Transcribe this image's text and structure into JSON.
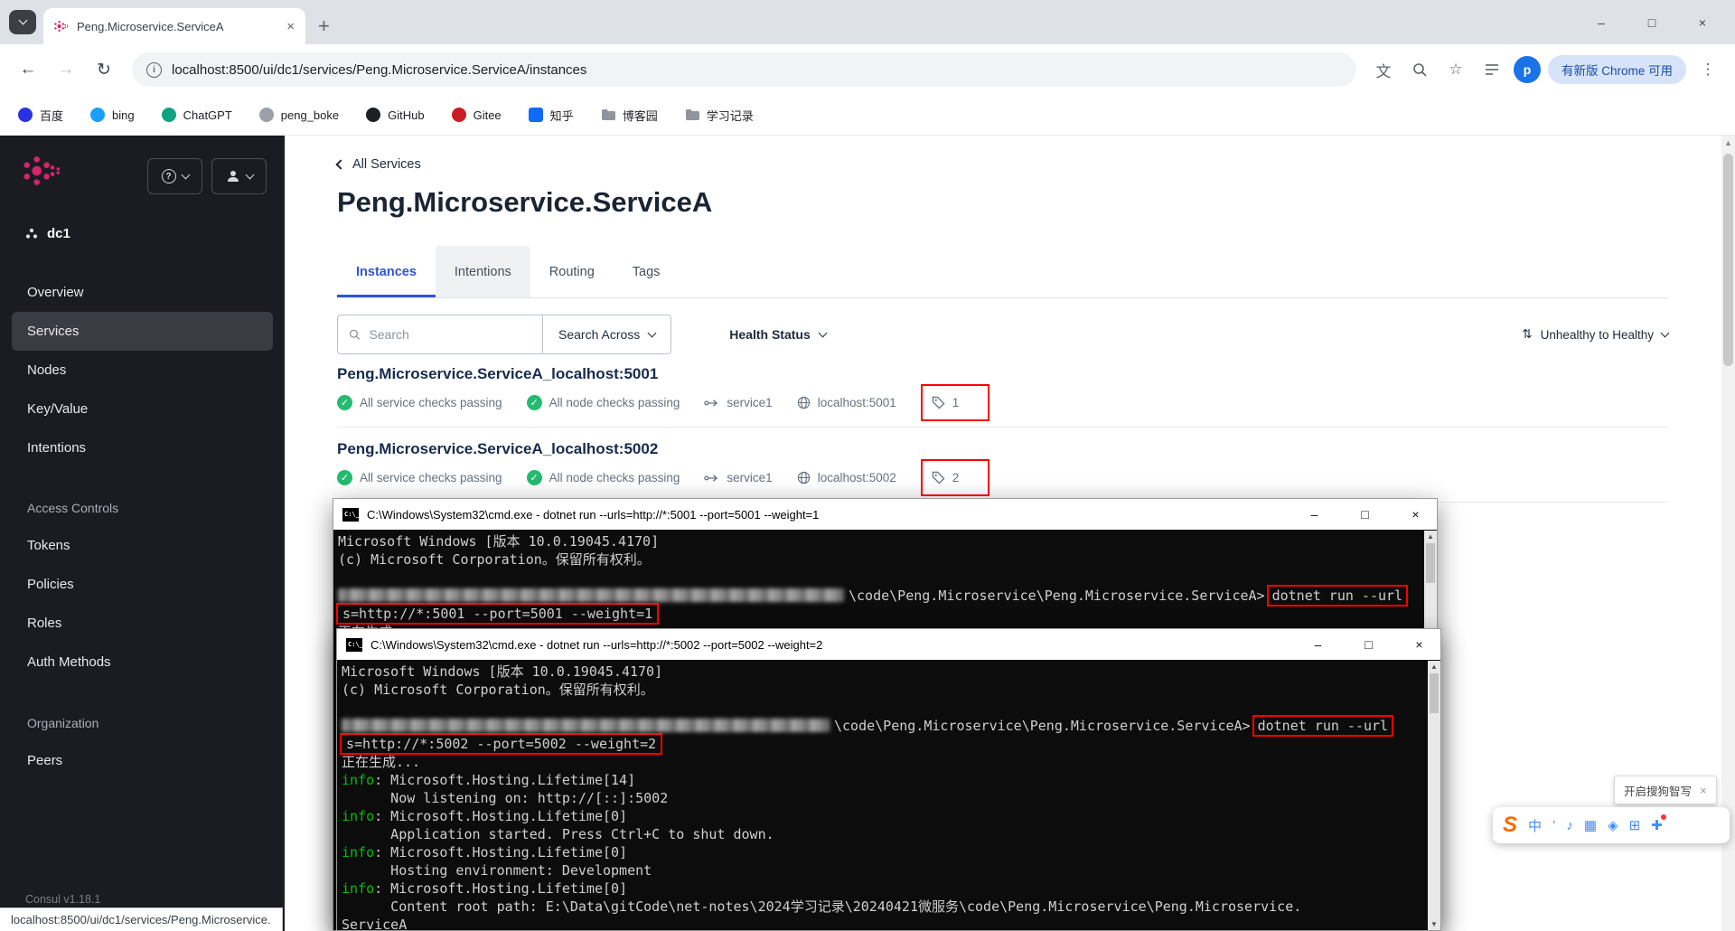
{
  "icons": {
    "check": "✓",
    "close": "×",
    "minimize": "–",
    "maximize": "□",
    "back": "←",
    "forward": "→",
    "reload": "↻",
    "star": "☆",
    "kebab": "⋮",
    "plus": "+",
    "sort": "⇅",
    "translate": "文",
    "info": "i",
    "question": "?",
    "up_arrow": "▲",
    "down_arrow": "▼",
    "cmd_logo": "C:\\_",
    "ime_logo": "S"
  },
  "browser": {
    "tab_title": "Peng.Microservice.ServiceA",
    "url": "localhost:8500/ui/dc1/services/Peng.Microservice.ServiceA/instances",
    "update_button": "有新版 Chrome 可用",
    "profile_initial": "p",
    "bookmarks": [
      "百度",
      "bing",
      "ChatGPT",
      "peng_boke",
      "GitHub",
      "Gitee",
      "知乎",
      "博客园",
      "学习记录"
    ]
  },
  "sidebar": {
    "dc": "dc1",
    "nav": [
      "Overview",
      "Services",
      "Nodes",
      "Key/Value",
      "Intentions"
    ],
    "acl_heading": "Access Controls",
    "acl_items": [
      "Tokens",
      "Policies",
      "Roles",
      "Auth Methods"
    ],
    "org_heading": "Organization",
    "peers": "Peers",
    "version": "Consul v1.18.1"
  },
  "main": {
    "back": "All Services",
    "title": "Peng.Microservice.ServiceA",
    "tabs": [
      "Instances",
      "Intentions",
      "Routing",
      "Tags"
    ],
    "search_placeholder": "Search",
    "search_across": "Search Across",
    "health_status": "Health Status",
    "sort_label": "Unhealthy to Healthy",
    "instances": [
      {
        "name": "Peng.Microservice.ServiceA_localhost:5001",
        "service_check": "All service checks passing",
        "node_check": "All node checks passing",
        "service": "service1",
        "address": "localhost:5001",
        "tag_count": "1"
      },
      {
        "name": "Peng.Microservice.ServiceA_localhost:5002",
        "service_check": "All service checks passing",
        "node_check": "All node checks passing",
        "service": "service1",
        "address": "localhost:5002",
        "tag_count": "2"
      }
    ]
  },
  "cmd1": {
    "title": "C:\\Windows\\System32\\cmd.exe - dotnet run --urls=http://*:5001 --port=5001 --weight=1",
    "lines": [
      {
        "text": "Microsoft Windows [版本 10.0.19045.4170]"
      },
      {
        "text": "(c) Microsoft Corporation。保留所有权利。"
      },
      {
        "text": ""
      },
      {
        "censored": true,
        "text": "\\code\\Peng.Microservice\\Peng.Microservice.ServiceA>",
        "tail": "dotnet run --url"
      },
      {
        "boxed": true,
        "text": "s=http://*:5001 --port=5001 --weight=1"
      },
      {
        "text": "正在生成..."
      }
    ]
  },
  "cmd2": {
    "title": "C:\\Windows\\System32\\cmd.exe - dotnet run --urls=http://*:5002 --port=5002 --weight=2",
    "lines": [
      {
        "text": "Microsoft Windows [版本 10.0.19045.4170]"
      },
      {
        "text": "(c) Microsoft Corporation。保留所有权利。"
      },
      {
        "text": ""
      },
      {
        "censored": true,
        "text": "\\code\\Peng.Microservice\\Peng.Microservice.ServiceA>",
        "tail": "dotnet run --url"
      },
      {
        "boxed": true,
        "text": "s=http://*:5002 --port=5002 --weight=2"
      },
      {
        "text": "正在生成..."
      },
      {
        "pre": "info",
        "text": ": Microsoft.Hosting.Lifetime[14]"
      },
      {
        "text": "      Now listening on: http://[::]:5002"
      },
      {
        "pre": "info",
        "text": ": Microsoft.Hosting.Lifetime[0]"
      },
      {
        "text": "      Application started. Press Ctrl+C to shut down."
      },
      {
        "pre": "info",
        "text": ": Microsoft.Hosting.Lifetime[0]"
      },
      {
        "text": "      Hosting environment: Development"
      },
      {
        "pre": "info",
        "text": ": Microsoft.Hosting.Lifetime[0]"
      },
      {
        "text": "      Content root path: E:\\Data\\gitCode\\net-notes\\2024学习记录\\20240421微服务\\code\\Peng.Microservice\\Peng.Microservice."
      },
      {
        "text": "ServiceA"
      }
    ]
  },
  "ime": {
    "tooltip": "开启搜狗智写",
    "icons": [
      "中",
      "’",
      "♪",
      "▦",
      "◈",
      "⊞",
      "✚"
    ]
  },
  "statusbar": "localhost:8500/ui/dc1/services/Peng.Microservice."
}
